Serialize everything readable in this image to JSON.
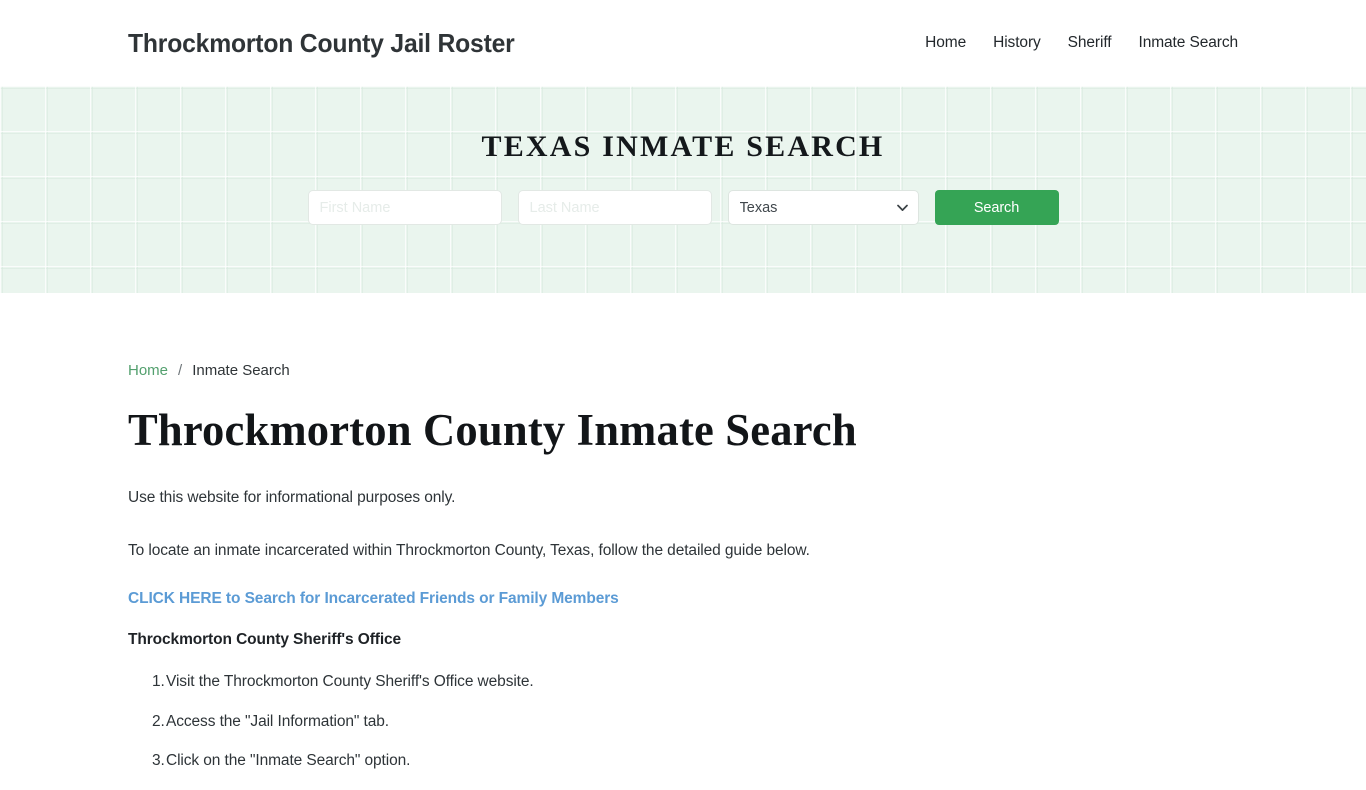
{
  "header": {
    "site_title": "Throckmorton County Jail Roster",
    "nav": [
      {
        "label": "Home"
      },
      {
        "label": "History"
      },
      {
        "label": "Sheriff"
      },
      {
        "label": "Inmate Search"
      }
    ]
  },
  "hero": {
    "title": "TEXAS INMATE SEARCH",
    "form": {
      "first_name_placeholder": "First Name",
      "first_name_value": "",
      "last_name_placeholder": "Last Name",
      "last_name_value": "",
      "state_selected": "Texas",
      "state_options": [
        "Texas"
      ],
      "search_button_label": "Search",
      "chevron_icon": "chevron-down-icon"
    },
    "background_color": "#eaf5ee"
  },
  "breadcrumb": {
    "home_label": "Home",
    "separator": "/",
    "current_label": "Inmate Search"
  },
  "main": {
    "heading": "Throckmorton County Inmate Search",
    "paragraph_1": "Use this website for informational purposes only.",
    "paragraph_2": "To locate an inmate incarcerated within Throckmorton County, Texas, follow the detailed guide below.",
    "cta_link_label": "CLICK HERE to Search for Incarcerated Friends or Family Members",
    "subheading": "Throckmorton County Sheriff's Office",
    "steps": [
      "Visit the Throckmorton County Sheriff's Office website.",
      "Access the \"Jail Information\" tab.",
      "Click on the \"Inmate Search\" option."
    ]
  },
  "colors": {
    "accent_green": "#35a455",
    "link_green": "#53a06e",
    "link_blue": "#5b9bd5"
  }
}
